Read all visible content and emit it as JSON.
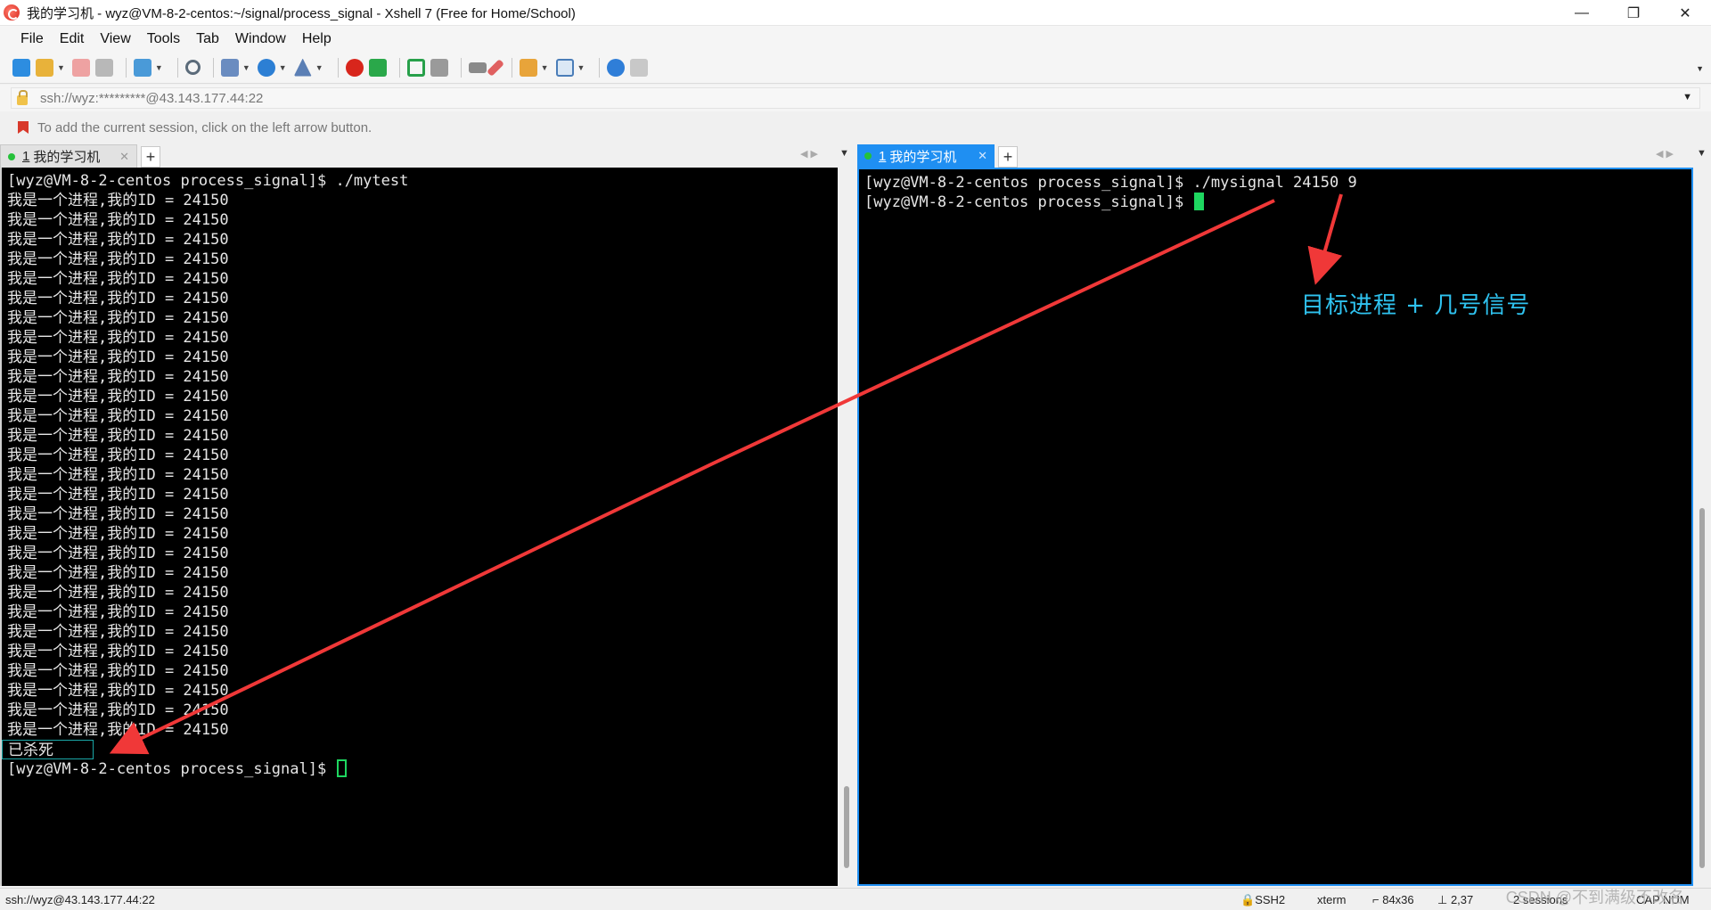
{
  "window": {
    "title": "我的学习机 - wyz@VM-8-2-centos:~/signal/process_signal - Xshell 7 (Free for Home/School)",
    "controls": {
      "minimize": "—",
      "restore": "❐",
      "close": "✕"
    }
  },
  "menu": [
    "File",
    "Edit",
    "View",
    "Tools",
    "Tab",
    "Window",
    "Help"
  ],
  "address": {
    "value": "ssh://wyz:*********@43.143.177.44:22"
  },
  "hint": {
    "text": "To add the current session, click on the left arrow button."
  },
  "left_pane": {
    "tab": {
      "number": "1",
      "label": "我的学习机"
    },
    "prompt_command": "[wyz@VM-8-2-centos process_signal]$ ./mytest",
    "output_line": "我是一个进程,我的ID = 24150",
    "output_count": 28,
    "killed": "已杀死",
    "final_prompt": "[wyz@VM-8-2-centos process_signal]$ "
  },
  "right_pane": {
    "tab": {
      "number": "1",
      "label": "我的学习机"
    },
    "line1": "[wyz@VM-8-2-centos process_signal]$ ./mysignal 24150 9",
    "line2": "[wyz@VM-8-2-centos process_signal]$ "
  },
  "annotation": {
    "text": "目标进程 + 几号信号",
    "color": "#2fc3f0"
  },
  "status": {
    "connection": "ssh://wyz@43.143.177.44:22",
    "protocol": "SSH2",
    "terminal": "xterm",
    "size": "84x36",
    "cursor_pos": "2,37",
    "sessions": "2 sessions",
    "caps": "CAP",
    "num": "NUM"
  },
  "watermark": "CSDN @不到满级不改名",
  "colors": {
    "terminal_bg": "#000000",
    "cursor": "#1ed760",
    "active_tab": "#1f8ff2",
    "arrow": "#f03838"
  }
}
